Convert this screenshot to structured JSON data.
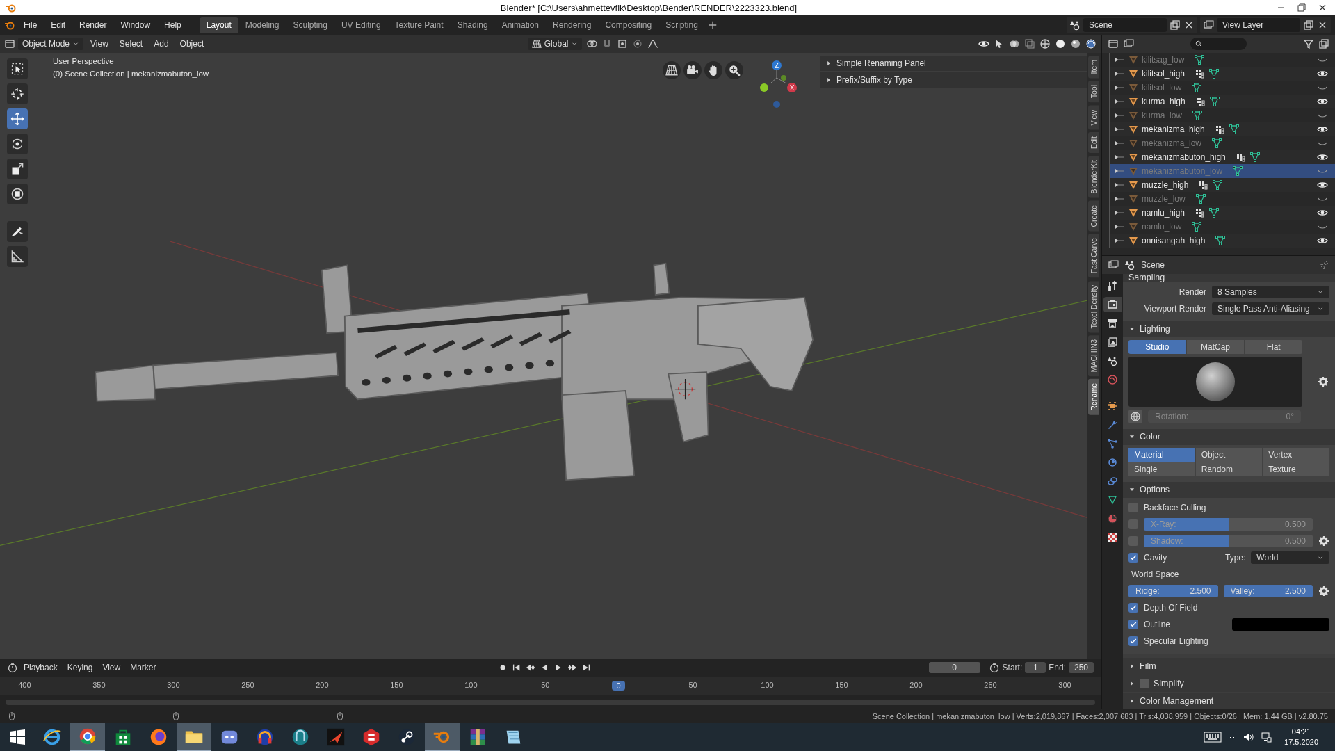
{
  "window": {
    "title": "Blender* [C:\\Users\\ahmettevfik\\Desktop\\Bender\\RENDER\\2223323.blend]"
  },
  "menu": [
    "File",
    "Edit",
    "Render",
    "Window",
    "Help"
  ],
  "workspaces": [
    {
      "label": "Layout",
      "selected": true
    },
    {
      "label": "Modeling",
      "selected": false
    },
    {
      "label": "Sculpting",
      "selected": false
    },
    {
      "label": "UV Editing",
      "selected": false
    },
    {
      "label": "Texture Paint",
      "selected": false
    },
    {
      "label": "Shading",
      "selected": false
    },
    {
      "label": "Animation",
      "selected": false
    },
    {
      "label": "Rendering",
      "selected": false
    },
    {
      "label": "Compositing",
      "selected": false
    },
    {
      "label": "Scripting",
      "selected": false
    }
  ],
  "scene_field": "Scene",
  "view_layer_field": "View Layer",
  "viewport": {
    "mode": "Object Mode",
    "menus": [
      "View",
      "Select",
      "Add",
      "Object"
    ],
    "orientation": "Global",
    "overlay_lines": [
      "User Perspective",
      "(0) Scene Collection | mekanizmabuton_low"
    ],
    "gizmo": {
      "z": "Z",
      "x": "X"
    },
    "tools": [
      {
        "kind": "select",
        "selected": false
      },
      {
        "kind": "cursor",
        "selected": false
      },
      {
        "kind": "move",
        "selected": true
      },
      {
        "kind": "rotate",
        "selected": false
      },
      {
        "kind": "scale",
        "selected": false
      },
      {
        "kind": "transform",
        "selected": false
      },
      {
        "kind": "annotate",
        "selected": false
      },
      {
        "kind": "measure",
        "selected": false
      }
    ],
    "sidebar_panels": [
      {
        "label": "Simple Renaming Panel",
        "expanded": false
      },
      {
        "label": "Prefix/Suffix by Type",
        "expanded": false
      }
    ],
    "sidebar_tabs": [
      {
        "label": "Item",
        "selected": false
      },
      {
        "label": "Tool",
        "selected": false
      },
      {
        "label": "View",
        "selected": false
      },
      {
        "label": "Edit",
        "selected": false
      },
      {
        "label": "BlenderKit",
        "selected": false
      },
      {
        "label": "Create",
        "selected": false
      },
      {
        "label": "Fast Carve",
        "selected": false
      },
      {
        "label": "Texel Density",
        "selected": false
      },
      {
        "label": "MACHIN3",
        "selected": false
      },
      {
        "label": "Rename",
        "selected": true
      }
    ]
  },
  "timeline": {
    "menus": [
      "Playback",
      "Keying",
      "View",
      "Marker"
    ],
    "current_frame": "0",
    "start_label": "Start:",
    "start": "1",
    "end_label": "End:",
    "end": "250",
    "ticks": [
      {
        "label": "-400",
        "selected": false
      },
      {
        "label": "-350",
        "selected": false
      },
      {
        "label": "-300",
        "selected": false
      },
      {
        "label": "-250",
        "selected": false
      },
      {
        "label": "-200",
        "selected": false
      },
      {
        "label": "-150",
        "selected": false
      },
      {
        "label": "-100",
        "selected": false
      },
      {
        "label": "-50",
        "selected": false
      },
      {
        "label": "0",
        "selected": true
      },
      {
        "label": "50",
        "selected": false
      },
      {
        "label": "100",
        "selected": false
      },
      {
        "label": "150",
        "selected": false
      },
      {
        "label": "200",
        "selected": false
      },
      {
        "label": "250",
        "selected": false
      },
      {
        "label": "300",
        "selected": false
      }
    ]
  },
  "outliner": {
    "items": [
      {
        "name": "kilitsag_low",
        "hidden": true,
        "modifiers": false,
        "selected": false
      },
      {
        "name": "kilitsol_high",
        "hidden": false,
        "modifiers": true,
        "selected": false
      },
      {
        "name": "kilitsol_low",
        "hidden": true,
        "modifiers": false,
        "selected": false
      },
      {
        "name": "kurma_high",
        "hidden": false,
        "modifiers": true,
        "selected": false
      },
      {
        "name": "kurma_low",
        "hidden": true,
        "modifiers": false,
        "selected": false
      },
      {
        "name": "mekanizma_high",
        "hidden": false,
        "modifiers": true,
        "selected": false
      },
      {
        "name": "mekanizma_low",
        "hidden": true,
        "modifiers": false,
        "selected": false
      },
      {
        "name": "mekanizmabuton_high",
        "hidden": false,
        "modifiers": true,
        "selected": false
      },
      {
        "name": "mekanizmabuton_low",
        "hidden": true,
        "modifiers": false,
        "selected": true
      },
      {
        "name": "muzzle_high",
        "hidden": false,
        "modifiers": true,
        "selected": false
      },
      {
        "name": "muzzle_low",
        "hidden": true,
        "modifiers": false,
        "selected": false
      },
      {
        "name": "namlu_high",
        "hidden": false,
        "modifiers": true,
        "selected": false
      },
      {
        "name": "namlu_low",
        "hidden": true,
        "modifiers": false,
        "selected": false
      },
      {
        "name": "onnisangah_high",
        "hidden": false,
        "modifiers": false,
        "selected": false
      }
    ]
  },
  "properties": {
    "context": "Scene",
    "tabs": [
      {
        "kind": "tool",
        "selected": false
      },
      {
        "kind": "render",
        "selected": true
      },
      {
        "kind": "output",
        "selected": false
      },
      {
        "kind": "view_layer",
        "selected": false
      },
      {
        "kind": "scene",
        "selected": false
      },
      {
        "kind": "world",
        "selected": false
      },
      {
        "kind": "object",
        "selected": false
      },
      {
        "kind": "modifiers",
        "selected": false
      },
      {
        "kind": "particles",
        "selected": false
      },
      {
        "kind": "physics",
        "selected": false
      },
      {
        "kind": "constraints",
        "selected": false
      },
      {
        "kind": "data",
        "selected": false
      },
      {
        "kind": "material",
        "selected": false
      },
      {
        "kind": "texture",
        "selected": false
      }
    ],
    "sampling": {
      "title": "Sampling",
      "rows": [
        {
          "label": "Render",
          "value": "8 Samples"
        },
        {
          "label": "Viewport Render",
          "value": "Single Pass Anti-Aliasing"
        }
      ]
    },
    "lighting": {
      "title": "Lighting",
      "expanded": true,
      "modes": [
        {
          "label": "Studio",
          "selected": true
        },
        {
          "label": "MatCap",
          "selected": false
        },
        {
          "label": "Flat",
          "selected": false
        }
      ],
      "rotation_label": "Rotation:",
      "rotation": "0°"
    },
    "color": {
      "title": "Color",
      "expanded": true,
      "options": [
        {
          "label": "Material",
          "selected": true
        },
        {
          "label": "Object",
          "selected": false
        },
        {
          "label": "Vertex",
          "selected": false
        },
        {
          "label": "Single",
          "selected": false
        },
        {
          "label": "Random",
          "selected": false
        },
        {
          "label": "Texture",
          "selected": false
        }
      ]
    },
    "options": {
      "title": "Options",
      "expanded": true,
      "backface_culling": {
        "label": "Backface Culling",
        "checked": false
      },
      "xray": {
        "label": "X-Ray:",
        "value": "0.500",
        "level": 0.5,
        "checked": false
      },
      "shadow": {
        "label": "Shadow:",
        "value": "0.500",
        "level": 0.5,
        "checked": false
      },
      "cavity": {
        "label": "Cavity",
        "checked": true,
        "type_label": "Type:",
        "type": "World"
      },
      "world_space": "World Space",
      "ridge": {
        "label": "Ridge:",
        "value": "2.500",
        "level": 1
      },
      "valley": {
        "label": "Valley:",
        "value": "2.500",
        "level": 1
      },
      "depth_of_field": {
        "label": "Depth Of Field",
        "checked": true
      },
      "outline": {
        "label": "Outline",
        "checked": true,
        "color": "#000000"
      },
      "specular": {
        "label": "Specular Lighting",
        "checked": true
      }
    },
    "collapsed_panels": [
      {
        "title": "Film",
        "expanded": false,
        "kind": "plain"
      },
      {
        "title": "Simplify",
        "expanded": false,
        "kind": "toggle",
        "checked": false
      },
      {
        "title": "Color Management",
        "expanded": false,
        "kind": "plain"
      }
    ]
  },
  "status_bar": {
    "text": "Scene Collection | mekanizmabuton_low | Verts:2,019,867 | Faces:2,007,683 | Tris:4,038,959 | Objects:0/26 | Mem: 1.44 GB | v2.80.75"
  },
  "taskbar": {
    "apps": [
      {
        "kind": "ie",
        "open": false
      },
      {
        "kind": "chrome",
        "open": true
      },
      {
        "kind": "store",
        "open": false
      },
      {
        "kind": "firefox",
        "open": false
      },
      {
        "kind": "explorer",
        "open": true
      },
      {
        "kind": "discord",
        "open": false
      },
      {
        "kind": "headphones",
        "open": false
      },
      {
        "kind": "teal",
        "open": false
      },
      {
        "kind": "arrow",
        "open": false
      },
      {
        "kind": "redshape",
        "open": false
      },
      {
        "kind": "steam",
        "open": false
      },
      {
        "kind": "blender",
        "open": true
      },
      {
        "kind": "archive",
        "open": false
      },
      {
        "kind": "notepad",
        "open": false
      }
    ],
    "time": "04:21",
    "date": "17.5.2020"
  }
}
